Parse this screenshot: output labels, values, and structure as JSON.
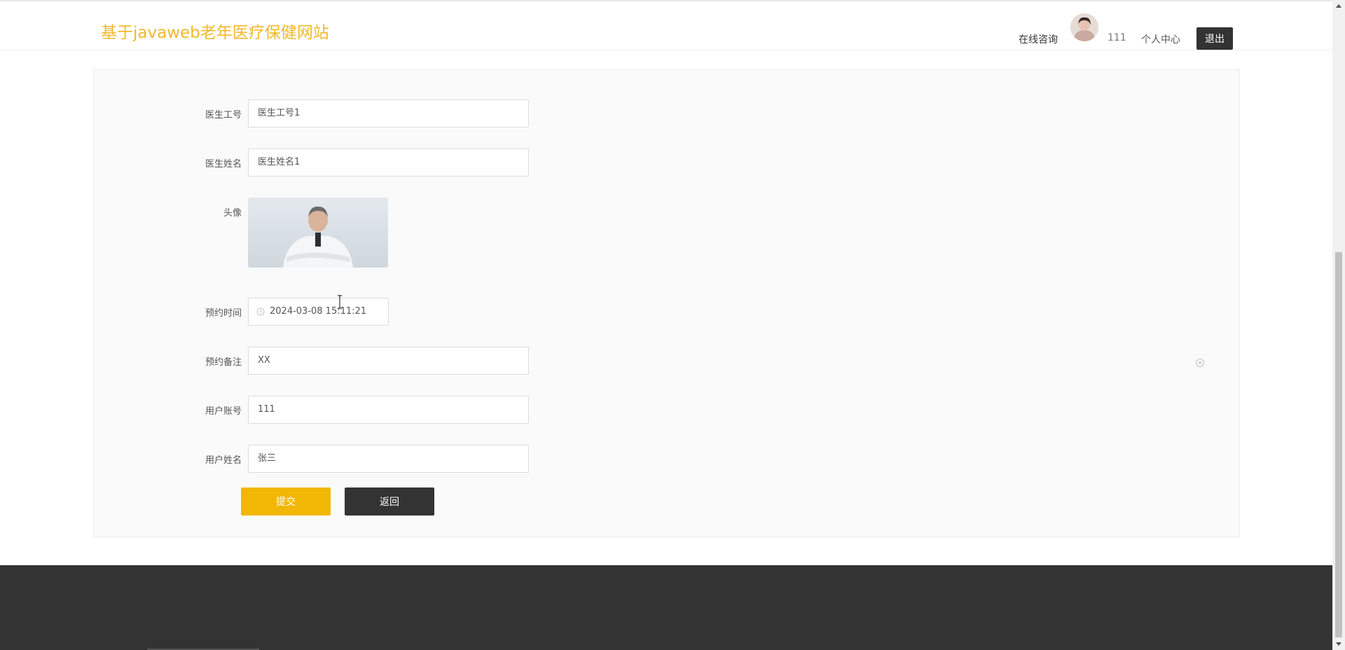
{
  "header": {
    "site_title": "基于javaweb老年医疗保健网站",
    "nav_consult": "在线咨询",
    "username": "111",
    "personal_center": "个人中心",
    "logout": "退出"
  },
  "form": {
    "doctor_id": {
      "label": "医生工号",
      "value": "医生工号1"
    },
    "doctor_name": {
      "label": "医生姓名",
      "value": "医生姓名1"
    },
    "avatar": {
      "label": "头像"
    },
    "appointment_time": {
      "label": "预约时间",
      "value": "2024-03-08 15:11:21"
    },
    "appointment_note": {
      "label": "预约备注",
      "value": "XX"
    },
    "user_account": {
      "label": "用户账号",
      "value": "111"
    },
    "user_name": {
      "label": "用户姓名",
      "value": "张三"
    },
    "submit": "提交",
    "back": "返回"
  },
  "icons": {
    "clock": "clock-icon",
    "clear": "clear-icon",
    "text_cursor": "text-cursor-icon"
  },
  "colors": {
    "brand": "#f0b92b",
    "submit": "#f2b705",
    "dark": "#333333"
  }
}
